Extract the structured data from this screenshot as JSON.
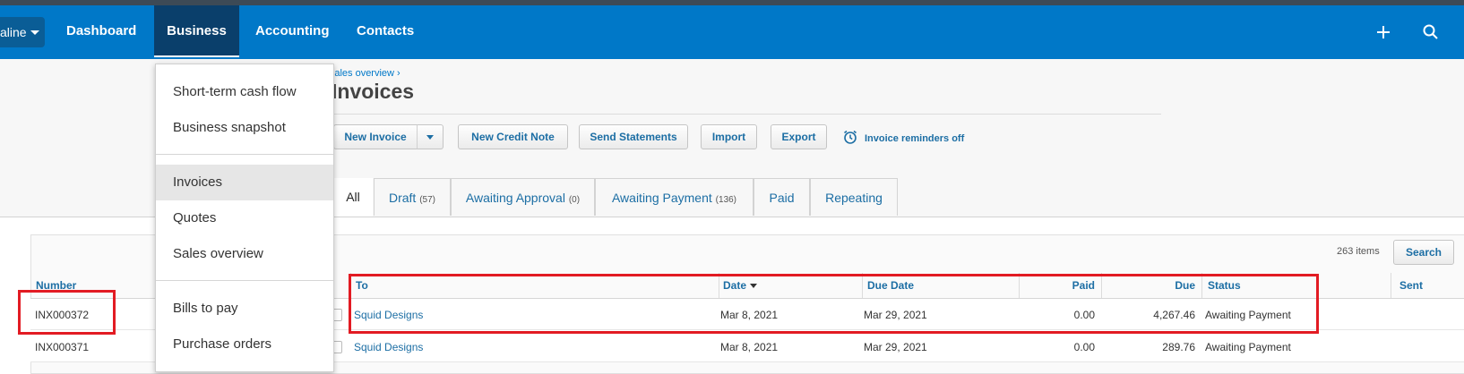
{
  "nav": {
    "org_label": "aline",
    "items": [
      {
        "label": "Dashboard"
      },
      {
        "label": "Business"
      },
      {
        "label": "Accounting"
      },
      {
        "label": "Contacts"
      }
    ]
  },
  "business_menu": {
    "group1": [
      "Short-term cash flow",
      "Business snapshot"
    ],
    "group2": [
      "Invoices",
      "Quotes",
      "Sales overview"
    ],
    "group3": [
      "Bills to pay",
      "Purchase orders"
    ]
  },
  "breadcrumb": "Sales overview ›",
  "page_title": "Invoices",
  "toolbar": {
    "new_invoice": "New Invoice",
    "new_credit_note": "New Credit Note",
    "send_statements": "Send Statements",
    "import": "Import",
    "export": "Export",
    "reminders": "Invoice reminders off"
  },
  "tabs": [
    {
      "label": "All",
      "count": ""
    },
    {
      "label": "Draft",
      "count": "(57)"
    },
    {
      "label": "Awaiting Approval",
      "count": "(0)"
    },
    {
      "label": "Awaiting Payment",
      "count": "(136)"
    },
    {
      "label": "Paid",
      "count": ""
    },
    {
      "label": "Repeating",
      "count": ""
    }
  ],
  "list": {
    "items_count": "263 items",
    "search_label": "Search",
    "columns": {
      "number": "Number",
      "to": "To",
      "date": "Date",
      "due_date": "Due Date",
      "paid": "Paid",
      "due": "Due",
      "status": "Status",
      "sent": "Sent"
    },
    "rows": [
      {
        "number": "INX000372",
        "to": "Squid Designs",
        "date": "Mar 8, 2021",
        "due_date": "Mar 29, 2021",
        "paid": "0.00",
        "due": "4,267.46",
        "status": "Awaiting Payment"
      },
      {
        "number": "INX000371",
        "to": "Squid Designs",
        "date": "Mar 8, 2021",
        "due_date": "Mar 29, 2021",
        "paid": "0.00",
        "due": "289.76",
        "status": "Awaiting Payment"
      }
    ]
  },
  "colors": {
    "nav_blue": "#0078c8",
    "nav_active": "#0a3f6b",
    "link_blue": "#1c6ea4",
    "highlight_red": "#e21b23"
  },
  "icons": [
    "chevron-down-icon",
    "plus-icon",
    "search-icon",
    "alarm-clock-icon",
    "sort-desc-icon"
  ]
}
